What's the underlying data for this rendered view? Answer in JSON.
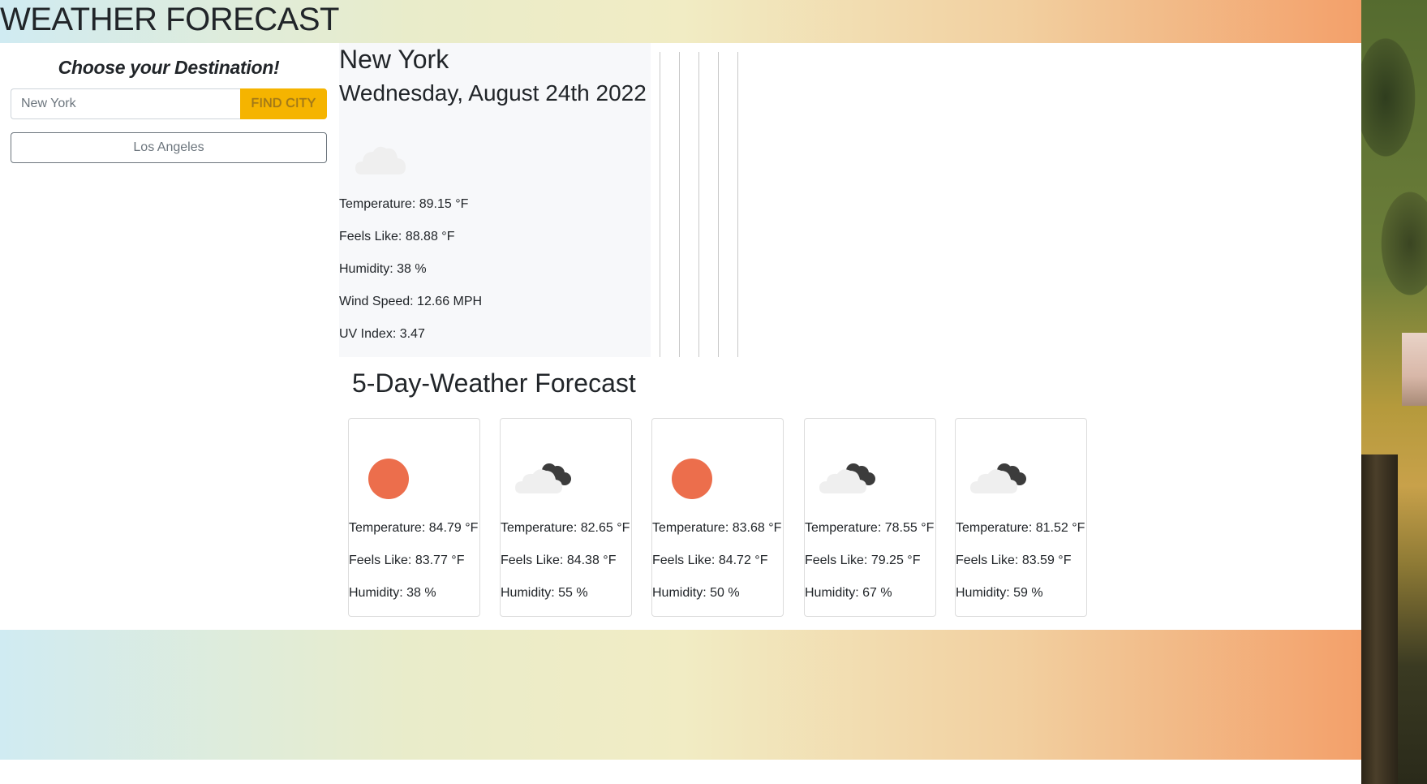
{
  "header": {
    "title": "WEATHER FORECAST"
  },
  "sidebar": {
    "heading": "Choose your Destination!",
    "search": {
      "value": "New York",
      "placeholder": "",
      "button_label": "FIND CITY"
    },
    "history": [
      {
        "label": "Los Angeles"
      }
    ]
  },
  "current": {
    "city": "New York",
    "date": "Wednesday, August 24th 2022",
    "icon": "cloud-icon",
    "temperature": "Temperature: 89.15 °F",
    "feels_like": "Feels Like: 88.88 °F",
    "humidity": "Humidity: 38 %",
    "wind_speed": "Wind Speed: 12.66 MPH",
    "uv_index": "UV Index: 3.47"
  },
  "forecast": {
    "title": "5-Day-Weather Forecast",
    "days": [
      {
        "icon": "sun-icon",
        "temperature": "Temperature: 84.79 °F",
        "feels_like": "Feels Like: 83.77 °F",
        "humidity": "Humidity: 38 %"
      },
      {
        "icon": "cloudy-icon",
        "temperature": "Temperature: 82.65 °F",
        "feels_like": "Feels Like: 84.38 °F",
        "humidity": "Humidity: 55 %"
      },
      {
        "icon": "sun-icon",
        "temperature": "Temperature: 83.68 °F",
        "feels_like": "Feels Like: 84.72 °F",
        "humidity": "Humidity: 50 %"
      },
      {
        "icon": "cloudy-icon",
        "temperature": "Temperature: 78.55 °F",
        "feels_like": "Feels Like: 79.25 °F",
        "humidity": "Humidity: 67 %"
      },
      {
        "icon": "cloudy-icon",
        "temperature": "Temperature: 81.52 °F",
        "feels_like": "Feels Like: 83.59 °F",
        "humidity": "Humidity: 59 %"
      }
    ]
  },
  "colors": {
    "accent_button": "#f5b400",
    "sun": "#ec6e4c",
    "cloud_light": "#efefef",
    "cloud_dark": "#3c3c3c",
    "gradient_start": "#d0ebf2",
    "gradient_end": "#f3a06a"
  }
}
